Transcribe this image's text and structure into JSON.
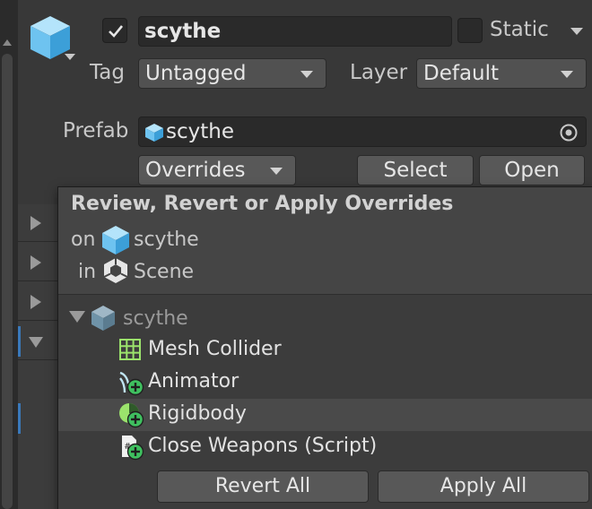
{
  "header": {
    "active_checked": true,
    "name": "scythe",
    "static_label": "Static",
    "tag_label": "Tag",
    "tag_value": "Untagged",
    "layer_label": "Layer",
    "layer_value": "Default",
    "prefab_label": "Prefab",
    "prefab_value": "scythe",
    "overrides_label": "Overrides",
    "select_label": "Select",
    "open_label": "Open"
  },
  "popup": {
    "title": "Review, Revert or Apply Overrides",
    "on_label": "on",
    "on_target": "scythe",
    "in_label": "in",
    "in_target": "Scene",
    "tree_root": "scythe",
    "items": [
      {
        "label": "Mesh Collider",
        "icon": "mesh-collider-icon"
      },
      {
        "label": "Animator",
        "icon": "animator-added-icon"
      },
      {
        "label": "Rigidbody",
        "icon": "rigidbody-added-icon"
      },
      {
        "label": "Close Weapons (Script)",
        "icon": "script-added-icon"
      }
    ],
    "revert_all_label": "Revert All",
    "apply_all_label": "Apply All"
  },
  "colors": {
    "background": "#383838",
    "field": "#2a2a2a",
    "button": "#585858",
    "prefab_cube": "#6ec3f0",
    "added_badge": "#3fbf5f"
  }
}
